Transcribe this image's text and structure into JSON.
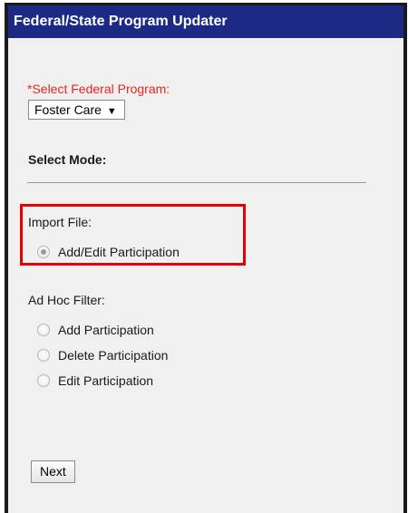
{
  "window": {
    "title": "Federal/State Program Updater"
  },
  "program": {
    "label": "*Select Federal Program:",
    "selected": "Foster Care"
  },
  "mode": {
    "label": "Select Mode:"
  },
  "import_file": {
    "label": "Import File:",
    "options": [
      {
        "label": "Add/Edit Participation",
        "checked": true
      }
    ]
  },
  "ad_hoc": {
    "label": "Ad Hoc Filter:",
    "options": [
      {
        "label": "Add Participation",
        "checked": false
      },
      {
        "label": "Delete Participation",
        "checked": false
      },
      {
        "label": "Edit Participation",
        "checked": false
      }
    ]
  },
  "actions": {
    "next_label": "Next"
  },
  "colors": {
    "titlebar": "#1c2a86",
    "required": "#e8251f",
    "highlight": "#e60000"
  }
}
